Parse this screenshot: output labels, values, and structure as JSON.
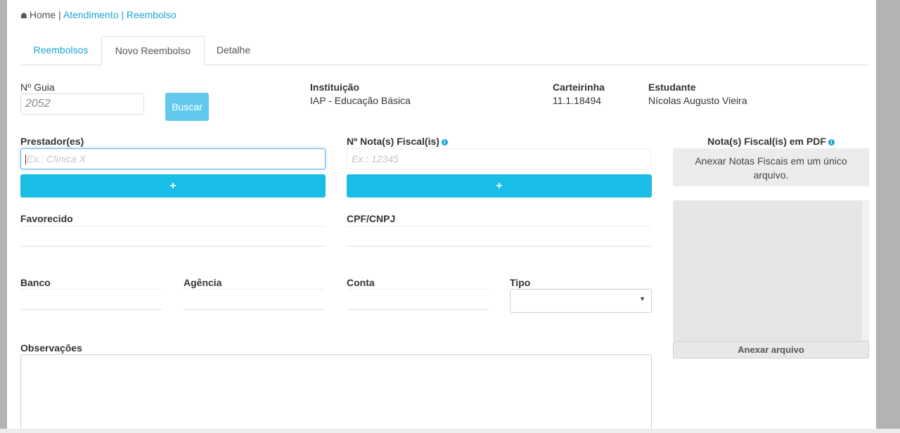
{
  "breadcrumb": {
    "home": "Home",
    "sep1": " | ",
    "item1": "Atendimento",
    "sep2": " | ",
    "item2": "Reembolso"
  },
  "tabs": [
    {
      "label": "Reembolsos"
    },
    {
      "label": "Novo Reembolso"
    },
    {
      "label": "Detalhe"
    }
  ],
  "guia": {
    "label": "Nº Guia",
    "value": "2052",
    "search_label": "Buscar"
  },
  "instituicao": {
    "label": "Instituição",
    "value": "IAP - Educação Básica"
  },
  "carteirinha": {
    "label": "Carteirinha",
    "value": "11.1.18494"
  },
  "estudante": {
    "label": "Estudante",
    "value": "Nícolas Augusto Vieira"
  },
  "prestador": {
    "label": "Prestador(es)",
    "placeholder": "Ex.: Clínica X",
    "add_label": "+"
  },
  "nota_fiscal": {
    "label": "Nº Nota(s) Fiscal(is)",
    "placeholder": "Ex.: 12345",
    "add_label": "+"
  },
  "pdf": {
    "label": "Nota(s) Fiscal(is) em PDF",
    "hint": "Anexar Notas Fiscais em um único arquivo.",
    "attach_label": "Anexar arquivo"
  },
  "favorecido": {
    "label": "Favorecido"
  },
  "cpf_cnpj": {
    "label": "CPF/CNPJ"
  },
  "banco": {
    "label": "Banco"
  },
  "agencia": {
    "label": "Agência"
  },
  "conta": {
    "label": "Conta"
  },
  "tipo": {
    "label": "Tipo"
  },
  "observacoes": {
    "label": "Observações"
  },
  "colors": {
    "accent": "#19bde6",
    "link": "#1ba5d6",
    "buscar": "#62c9ee"
  }
}
